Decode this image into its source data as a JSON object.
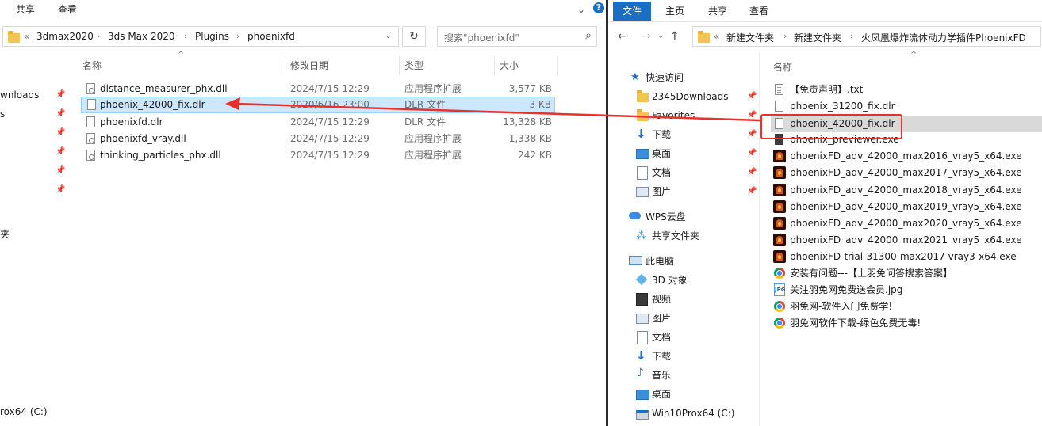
{
  "left_window": {
    "ribbon_tabs": [
      "共享",
      "查看"
    ],
    "address": {
      "overflow": "«",
      "crumbs": [
        "3dmax2020",
        "3ds Max 2020",
        "Plugins",
        "phoenixfd"
      ]
    },
    "search_placeholder": "搜索\"phoenixfd\"",
    "nav_items": [
      "wnloads",
      "s",
      "夹",
      "rox64 (C:)"
    ],
    "columns": {
      "name": "名称",
      "date": "修改日期",
      "type": "类型",
      "size": "大小"
    },
    "files": [
      {
        "name": "distance_measurer_phx.dll",
        "date": "2024/7/15 12:29",
        "type": "应用程序扩展",
        "size": "3,577 KB",
        "icon": "dll-file-icon"
      },
      {
        "name": "phoenix_42000_fix.dlr",
        "date": "2020/6/16 23:00",
        "type": "DLR 文件",
        "size": "3 KB",
        "icon": "file-icon",
        "selected": true
      },
      {
        "name": "phoenixfd.dlr",
        "date": "2024/7/15 12:29",
        "type": "DLR 文件",
        "size": "13,328 KB",
        "icon": "file-icon"
      },
      {
        "name": "phoenixfd_vray.dll",
        "date": "2024/7/15 12:29",
        "type": "应用程序扩展",
        "size": "1,338 KB",
        "icon": "dll-file-icon"
      },
      {
        "name": "thinking_particles_phx.dll",
        "date": "2024/7/15 12:29",
        "type": "应用程序扩展",
        "size": "242 KB",
        "icon": "dll-file-icon"
      }
    ]
  },
  "right_window": {
    "ribbon_tabs": [
      "文件",
      "主页",
      "共享",
      "查看"
    ],
    "address": {
      "overflow": "«",
      "crumbs": [
        "新建文件夹",
        "新建文件夹",
        "火凤凰爆炸流体动力学插件PhoenixFD"
      ]
    },
    "nav": {
      "quick_access": "快速访问",
      "quick_items": [
        {
          "label": "2345Downloads",
          "icon": "folder-icon"
        },
        {
          "label": "Favorites",
          "icon": "folder-icon"
        },
        {
          "label": "下载",
          "icon": "download-icon"
        },
        {
          "label": "桌面",
          "icon": "desktop-icon"
        },
        {
          "label": "文档",
          "icon": "document-icon"
        },
        {
          "label": "图片",
          "icon": "picture-icon"
        }
      ],
      "wps": "WPS云盘",
      "shared": "共享文件夹",
      "this_pc": "此电脑",
      "pc_items": [
        {
          "label": "3D 对象",
          "icon": "3d-objects-icon"
        },
        {
          "label": "视频",
          "icon": "video-icon"
        },
        {
          "label": "图片",
          "icon": "picture-icon"
        },
        {
          "label": "文档",
          "icon": "document-icon"
        },
        {
          "label": "下载",
          "icon": "download-icon"
        },
        {
          "label": "音乐",
          "icon": "music-icon"
        },
        {
          "label": "桌面",
          "icon": "desktop-icon"
        },
        {
          "label": "Win10Prox64 (C:)",
          "icon": "drive-icon"
        }
      ]
    },
    "column_name": "名称",
    "files": [
      {
        "name": "【免责声明】.txt",
        "icon": "txt-file-icon"
      },
      {
        "name": "phoenix_31200_fix.dlr",
        "icon": "file-icon"
      },
      {
        "name": "phoenix_42000_fix.dlr",
        "icon": "file-icon",
        "highlighted": true
      },
      {
        "name": "phoenix_previewer.exe",
        "icon": "exe-file-icon"
      },
      {
        "name": "phoenixFD_adv_42000_max2016_vray5_x64.exe",
        "icon": "phoenix-installer-icon"
      },
      {
        "name": "phoenixFD_adv_42000_max2017_vray5_x64.exe",
        "icon": "phoenix-installer-icon"
      },
      {
        "name": "phoenixFD_adv_42000_max2018_vray5_x64.exe",
        "icon": "phoenix-installer-icon"
      },
      {
        "name": "phoenixFD_adv_42000_max2019_vray5_x64.exe",
        "icon": "phoenix-installer-icon"
      },
      {
        "name": "phoenixFD_adv_42000_max2020_vray5_x64.exe",
        "icon": "phoenix-installer-icon"
      },
      {
        "name": "phoenixFD_adv_42000_max2021_vray5_x64.exe",
        "icon": "phoenix-installer-icon"
      },
      {
        "name": "phoenixFD-trial-31300-max2017-vray3-x64.exe",
        "icon": "phoenix-installer-icon"
      },
      {
        "name": "安装有问题---【上羽免问答搜索答案】",
        "icon": "chrome-link-icon"
      },
      {
        "name": "关注羽免网免费送会员.jpg",
        "icon": "jpg-file-icon"
      },
      {
        "name": "羽免网-软件入门免费学!",
        "icon": "chrome-link-icon"
      },
      {
        "name": "羽免网软件下载-绿色免费无毒!",
        "icon": "chrome-link-icon"
      }
    ]
  },
  "colors": {
    "accent": "#1a6fc4",
    "selection": "#cce8ff",
    "annotation_red": "#e8312a"
  }
}
